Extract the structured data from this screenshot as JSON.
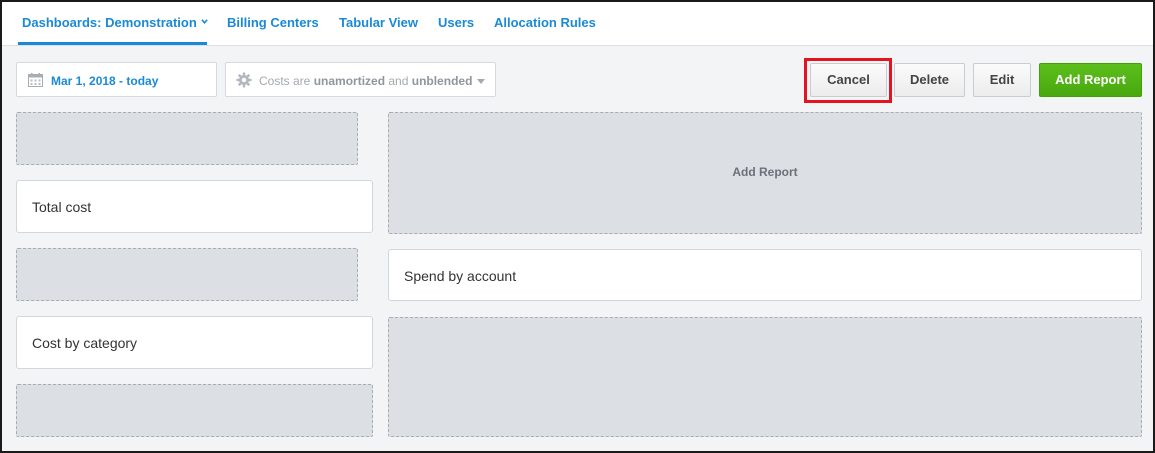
{
  "nav": {
    "items": [
      {
        "label": "Dashboards: Demonstration",
        "active": true
      },
      {
        "label": "Billing Centers"
      },
      {
        "label": "Tabular View"
      },
      {
        "label": "Users"
      },
      {
        "label": "Allocation Rules"
      }
    ]
  },
  "toolbar": {
    "date_range": "Mar 1, 2018 - today",
    "cost_prefix": "Costs are ",
    "cost_mode_1": "unamortized",
    "cost_and": " and ",
    "cost_mode_2": "unblended",
    "cancel_label": "Cancel",
    "delete_label": "Delete",
    "edit_label": "Edit",
    "add_report_label": "Add Report"
  },
  "colors": {
    "accent": "#1a8ad6",
    "add_button": "#4fb314",
    "highlight": "#e3141f"
  },
  "cards": {
    "total_cost": "Total cost",
    "cost_by_category": "Cost by category",
    "spend_by_account": "Spend by account",
    "add_report_drop": "Add Report"
  }
}
